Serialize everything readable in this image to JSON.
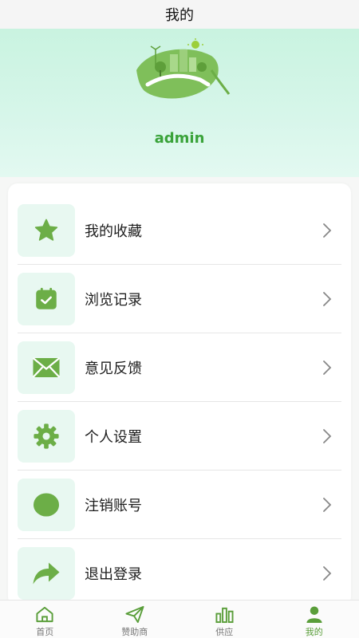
{
  "header": {
    "title": "我的"
  },
  "profile": {
    "username": "admin"
  },
  "menu": [
    {
      "label": "我的收藏",
      "icon": "star-icon"
    },
    {
      "label": "浏览记录",
      "icon": "calendar-check-icon"
    },
    {
      "label": "意见反馈",
      "icon": "envelope-icon"
    },
    {
      "label": "个人设置",
      "icon": "gear-icon"
    },
    {
      "label": "注销账号",
      "icon": "circle-icon"
    },
    {
      "label": "退出登录",
      "icon": "share-arrow-icon"
    }
  ],
  "tabs": [
    {
      "label": "首页",
      "icon": "home-icon",
      "active": false
    },
    {
      "label": "赞助商",
      "icon": "paper-plane-icon",
      "active": false
    },
    {
      "label": "供应",
      "icon": "bar-chart-icon",
      "active": false
    },
    {
      "label": "我的",
      "icon": "user-icon",
      "active": true
    }
  ],
  "colors": {
    "accent": "#6cae47",
    "username": "#3aa33a",
    "hero_bg": "#d3f5e6",
    "icon_bg": "#e8f8f1"
  }
}
